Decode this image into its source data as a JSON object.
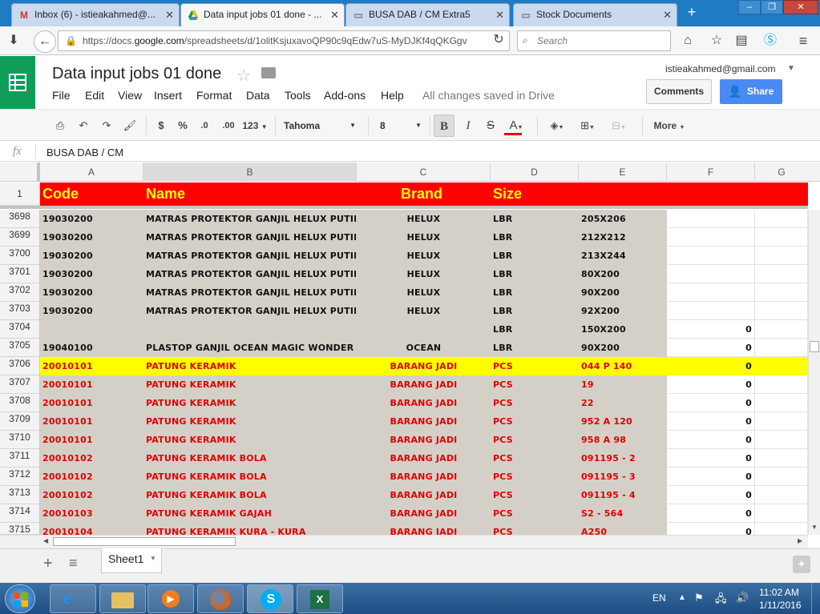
{
  "browser": {
    "tabs": [
      {
        "label": "Inbox (6) - istieakahmed@...",
        "icon": "gmail-icon",
        "active": false
      },
      {
        "label": "Data input jobs 01 done - ...",
        "icon": "drive-icon",
        "active": true
      },
      {
        "label": "BUSA DAB / CM Extra5",
        "icon": "page-icon",
        "active": false
      },
      {
        "label": "Stock Documents",
        "icon": "page-icon",
        "active": false
      }
    ],
    "url_prefix": "https://docs.",
    "url_domain": "google.com",
    "url_rest": "/spreadsheets/d/1olitKsjuxavoQP90c9qEdw7uS-MyDJKf4qQKGgv",
    "search_placeholder": "Search"
  },
  "doc": {
    "title": "Data input jobs 01 done",
    "menu": [
      "File",
      "Edit",
      "View",
      "Insert",
      "Format",
      "Data",
      "Tools",
      "Add-ons",
      "Help"
    ],
    "saved_status": "All changes saved in Drive",
    "user_email": "istieakahmed@gmail.com",
    "comments_label": "Comments",
    "share_label": "Share"
  },
  "toolbar": {
    "currency": "$",
    "percent": "%",
    "dec_less": ".0",
    "dec_more": ".00",
    "format_more": "123",
    "font": "Tahoma",
    "font_size": "8",
    "bold": "B",
    "italic": "I",
    "strike": "S",
    "text_color": "A",
    "more": "More"
  },
  "formula_bar": {
    "fx": "fx",
    "value": "BUSA DAB / CM"
  },
  "columns": [
    "A",
    "B",
    "C",
    "D",
    "E",
    "F",
    "G"
  ],
  "header_row": {
    "num": "1",
    "code": "Code",
    "name": "Name",
    "brand": "Brand",
    "size": "Size"
  },
  "rows": [
    {
      "num": "3698",
      "code": "19030200",
      "name": "MATRAS PROTEKTOR GANJIL HELUX PUTIH",
      "brand": "HELUX",
      "unit": "LBR",
      "size": "205X206",
      "f": "",
      "style": "black"
    },
    {
      "num": "3699",
      "code": "19030200",
      "name": "MATRAS PROTEKTOR GANJIL HELUX PUTIH",
      "brand": "HELUX",
      "unit": "LBR",
      "size": "212X212",
      "f": "",
      "style": "black"
    },
    {
      "num": "3700",
      "code": "19030200",
      "name": "MATRAS PROTEKTOR GANJIL HELUX PUTIH",
      "brand": "HELUX",
      "unit": "LBR",
      "size": "213X244",
      "f": "",
      "style": "black"
    },
    {
      "num": "3701",
      "code": "19030200",
      "name": "MATRAS PROTEKTOR GANJIL HELUX PUTIH",
      "brand": "HELUX",
      "unit": "LBR",
      "size": "80X200",
      "f": "",
      "style": "black"
    },
    {
      "num": "3702",
      "code": "19030200",
      "name": "MATRAS PROTEKTOR GANJIL HELUX PUTIH",
      "brand": "HELUX",
      "unit": "LBR",
      "size": "90X200",
      "f": "",
      "style": "black"
    },
    {
      "num": "3703",
      "code": "19030200",
      "name": "MATRAS PROTEKTOR GANJIL HELUX PUTIH",
      "brand": "HELUX",
      "unit": "LBR",
      "size": "92X200",
      "f": "",
      "style": "black"
    },
    {
      "num": "3704",
      "code": "",
      "name": "",
      "brand": "",
      "unit": "LBR",
      "size": "150X200",
      "f": "0",
      "style": "black"
    },
    {
      "num": "3705",
      "code": "19040100",
      "name": "PLASTOP GANJIL OCEAN MAGIC WONDER",
      "brand": "OCEAN",
      "unit": "LBR",
      "size": "90X200",
      "f": "0",
      "style": "black"
    },
    {
      "num": "3706",
      "code": "20010101",
      "name": "PATUNG KERAMIK",
      "brand": "BARANG JADI",
      "unit": "PCS",
      "size": "044 P 140",
      "f": "0",
      "style": "highlight"
    },
    {
      "num": "3707",
      "code": "20010101",
      "name": "PATUNG KERAMIK",
      "brand": "BARANG JADI",
      "unit": "PCS",
      "size": "19",
      "f": "0",
      "style": "red"
    },
    {
      "num": "3708",
      "code": "20010101",
      "name": "PATUNG KERAMIK",
      "brand": "BARANG JADI",
      "unit": "PCS",
      "size": "22",
      "f": "0",
      "style": "red"
    },
    {
      "num": "3709",
      "code": "20010101",
      "name": "PATUNG KERAMIK",
      "brand": "BARANG JADI",
      "unit": "PCS",
      "size": "952 A 120",
      "f": "0",
      "style": "red"
    },
    {
      "num": "3710",
      "code": "20010101",
      "name": "PATUNG KERAMIK",
      "brand": "BARANG JADI",
      "unit": "PCS",
      "size": "958 A 98",
      "f": "0",
      "style": "red"
    },
    {
      "num": "3711",
      "code": "20010102",
      "name": "PATUNG KERAMIK BOLA",
      "brand": "BARANG JADI",
      "unit": "PCS",
      "size": "091195 - 2",
      "f": "0",
      "style": "red"
    },
    {
      "num": "3712",
      "code": "20010102",
      "name": "PATUNG KERAMIK BOLA",
      "brand": "BARANG JADI",
      "unit": "PCS",
      "size": "091195 - 3",
      "f": "0",
      "style": "red"
    },
    {
      "num": "3713",
      "code": "20010102",
      "name": "PATUNG KERAMIK BOLA",
      "brand": "BARANG JADI",
      "unit": "PCS",
      "size": "091195 - 4",
      "f": "0",
      "style": "red"
    },
    {
      "num": "3714",
      "code": "20010103",
      "name": "PATUNG KERAMIK GAJAH",
      "brand": "BARANG JADI",
      "unit": "PCS",
      "size": "S2 - 564",
      "f": "0",
      "style": "red"
    },
    {
      "num": "3715",
      "code": "20010104",
      "name": "PATUNG KERAMIK KURA - KURA",
      "brand": "BARANG JADI",
      "unit": "PCS",
      "size": "A250",
      "f": "0",
      "style": "red"
    }
  ],
  "sheet_tab": "Sheet1",
  "taskbar": {
    "lang": "EN",
    "time": "11:02 AM",
    "date": "1/11/2016",
    "apps": [
      "internet-explorer-icon",
      "file-explorer-icon",
      "media-player-icon",
      "firefox-icon",
      "skype-icon",
      "excel-icon"
    ]
  },
  "colors": {
    "header_red": "#ff0000",
    "header_text": "#ffff00",
    "row_gray": "#d4d0c8",
    "highlight": "#ffff00",
    "red_text": "#e00000",
    "sheets_green": "#0f9d58",
    "share_blue": "#4a8af4"
  }
}
